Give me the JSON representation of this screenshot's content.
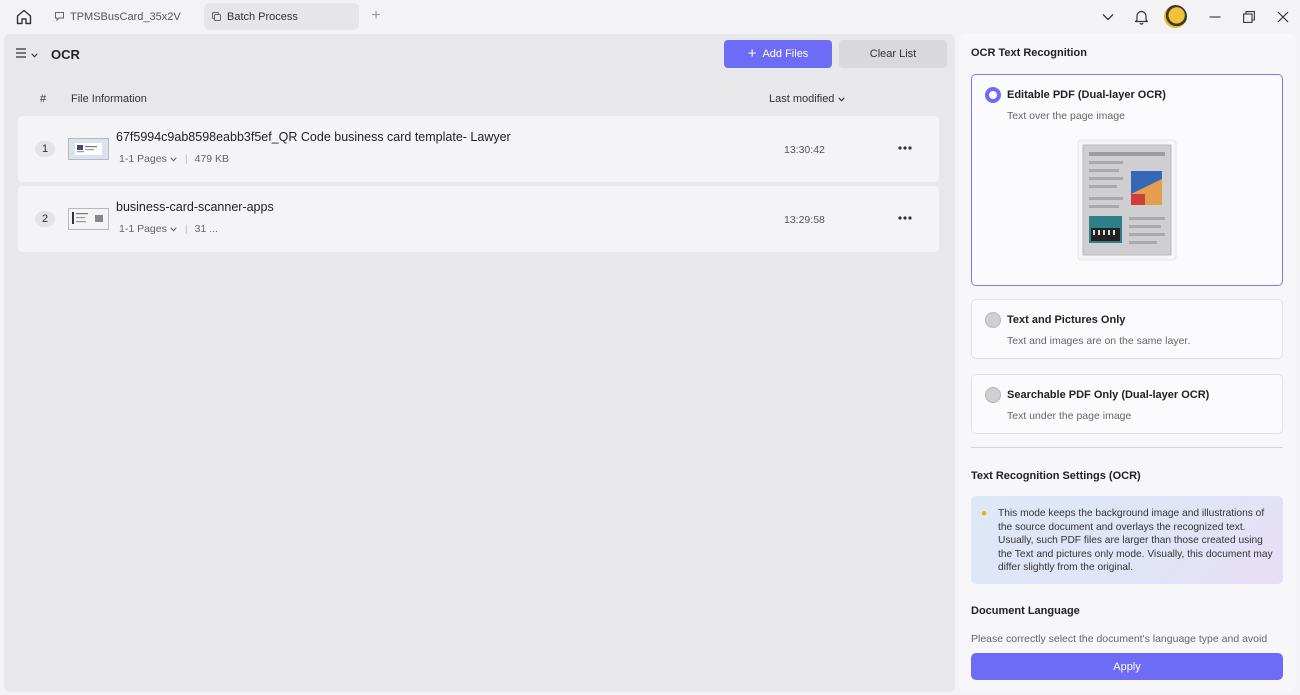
{
  "titlebar": {
    "tabs": [
      {
        "label": "TPMSBusCard_35x2V",
        "icon": "comment-icon"
      },
      {
        "label": "Batch Process",
        "icon": "copy-icon"
      }
    ],
    "add_tab_label": "+"
  },
  "header": {
    "title": "OCR",
    "add_files_label": "Add Files",
    "clear_list_label": "Clear List"
  },
  "table": {
    "columns": {
      "number": "#",
      "info": "File Information",
      "modified": "Last modified"
    },
    "rows": [
      {
        "num": "1",
        "name": "67f5994c9ab8598eabb3f5ef_QR Code business card template- Lawyer",
        "pages": "1-1 Pages",
        "size": "479 KB",
        "time": "13:30:42"
      },
      {
        "num": "2",
        "name": "business-card-scanner-apps",
        "pages": "1-1 Pages",
        "size": "31 ...",
        "time": "13:29:58"
      }
    ]
  },
  "ocr_panel": {
    "title": "OCR Text Recognition",
    "options": [
      {
        "title": "Editable PDF (Dual-layer OCR)",
        "desc": "Text over the page image",
        "selected": true
      },
      {
        "title": "Text and Pictures Only",
        "desc": "Text and images are on the same layer.",
        "selected": false
      },
      {
        "title": "Searchable PDF Only (Dual-layer OCR)",
        "desc": "Text under the page image",
        "selected": false
      }
    ],
    "settings_title": "Text Recognition Settings (OCR)",
    "settings_info": "This mode keeps the background image and illustrations of the source document and overlays the recognized text. Usually, such PDF files are larger than those created using the Text and pictures only mode. Visually, this document may differ slightly from the original.",
    "language_title": "Document Language",
    "language_desc": "Please correctly select the document's language type and avoid",
    "apply_label": "Apply"
  },
  "colors": {
    "accent": "#6d6cf6",
    "panel_bg": "#e8e8eb"
  }
}
